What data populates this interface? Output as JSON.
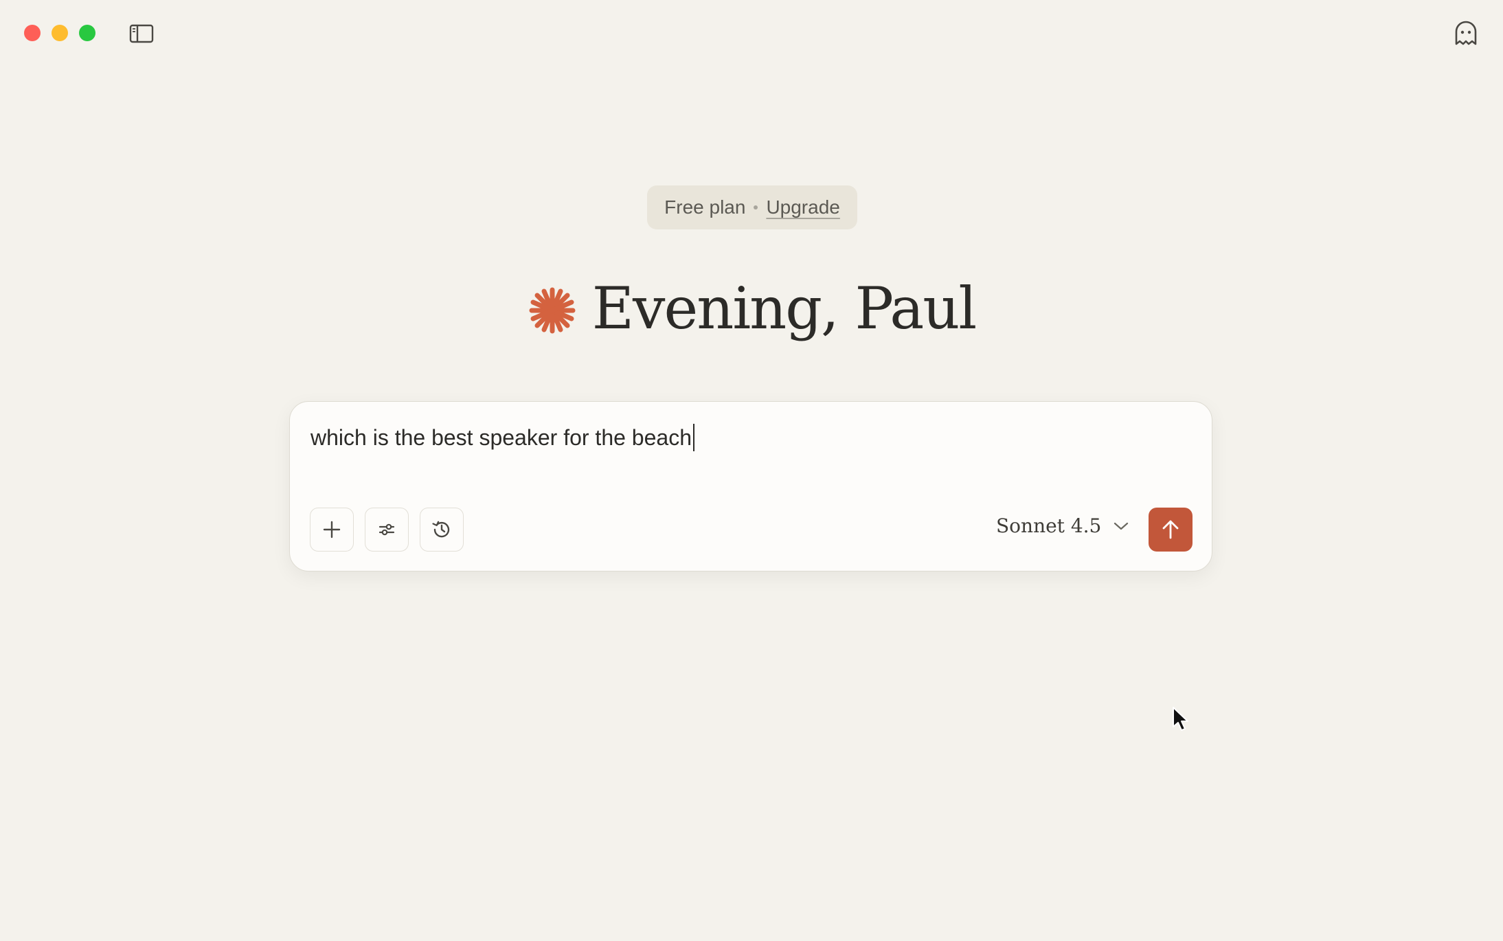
{
  "window": {
    "traffic_lights": {
      "close": "#fe5f57",
      "minimize": "#febc2e",
      "maximize": "#28c840"
    }
  },
  "plan": {
    "label": "Free plan",
    "upgrade_label": "Upgrade"
  },
  "greeting": {
    "text": "Evening, Paul",
    "icon": "claude-star-icon",
    "accent": "#d4623f"
  },
  "composer": {
    "input_value": "which is the best speaker for the beach",
    "tools": [
      {
        "name": "add-button",
        "icon": "plus-icon"
      },
      {
        "name": "settings-button",
        "icon": "sliders-icon"
      },
      {
        "name": "history-button",
        "icon": "clock-icon"
      }
    ],
    "model_label": "Sonnet 4.5",
    "send_color": "#c2573a"
  },
  "top_right": {
    "icon": "ghost-icon"
  }
}
